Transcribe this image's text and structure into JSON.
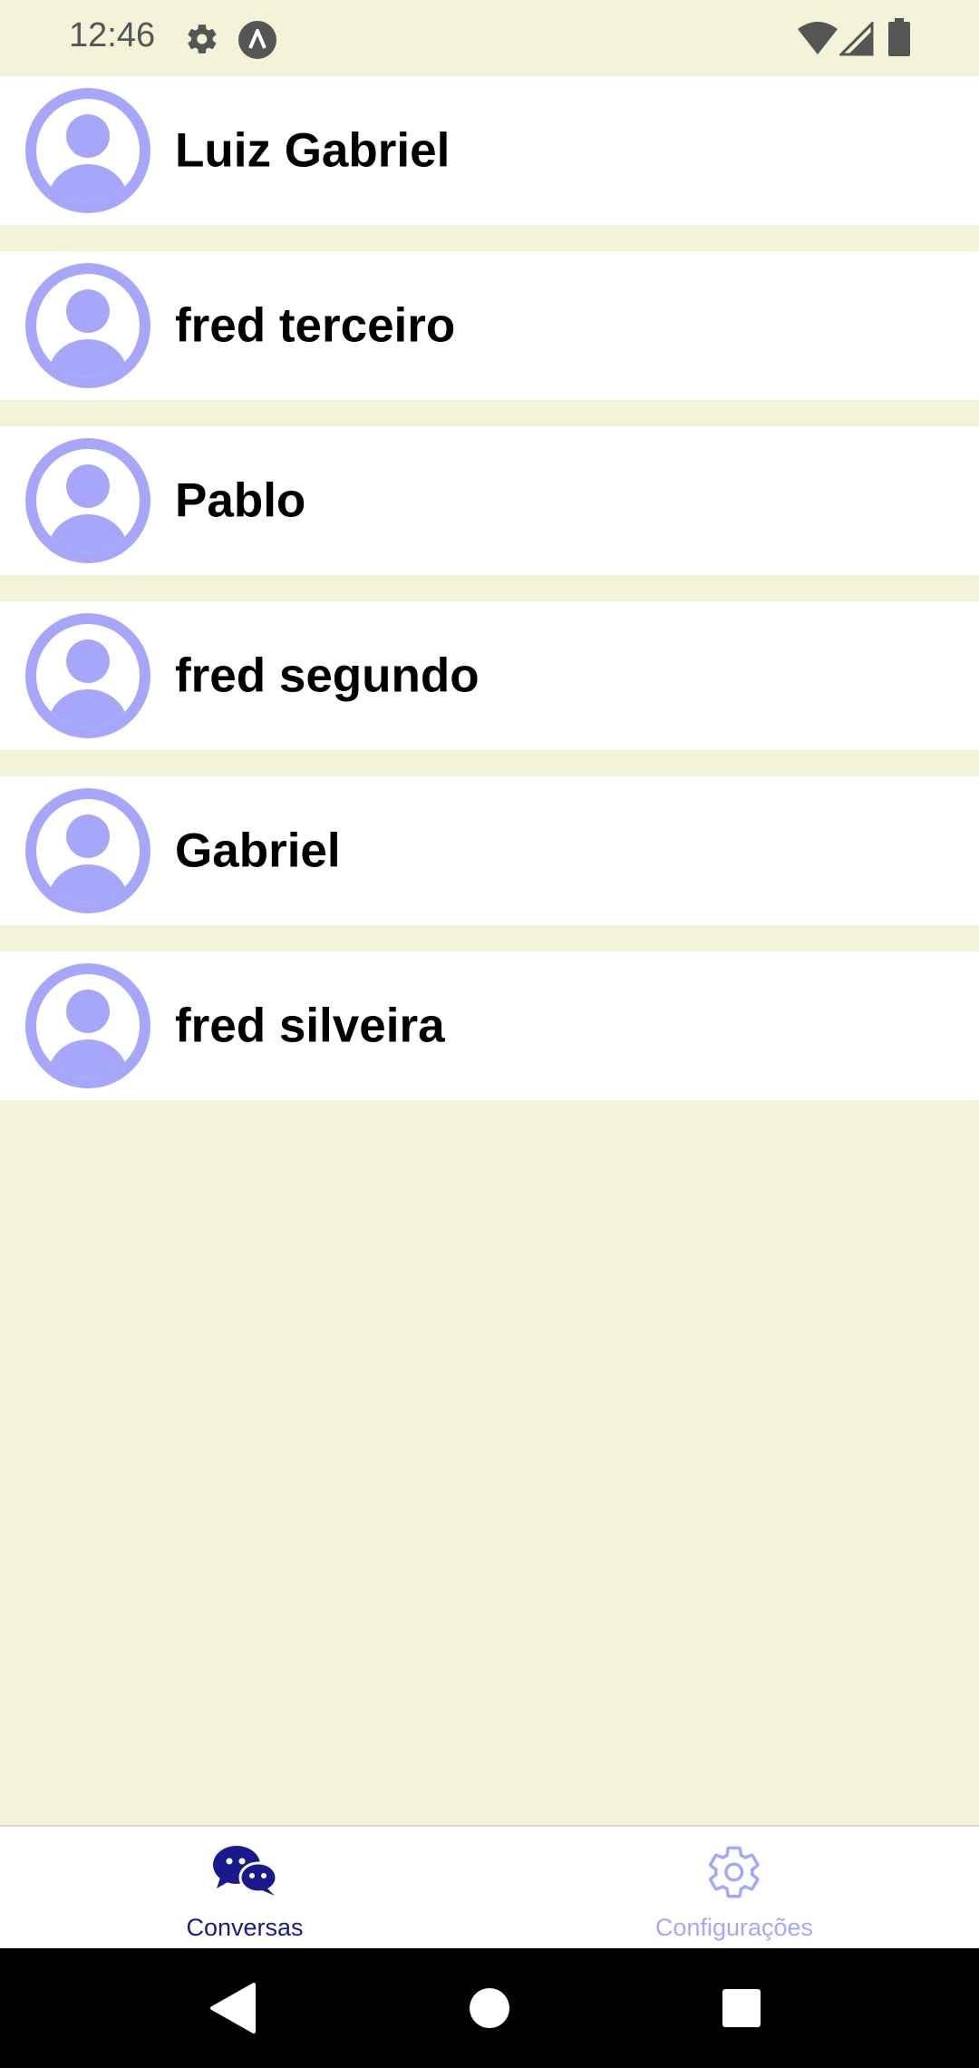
{
  "status_bar": {
    "time": "12:46",
    "icons": [
      "gear-icon",
      "app-notification-icon",
      "wifi-icon",
      "signal-icon",
      "battery-icon"
    ]
  },
  "contacts": [
    {
      "name": "Luiz Gabriel"
    },
    {
      "name": "fred terceiro"
    },
    {
      "name": "Pablo"
    },
    {
      "name": "fred segundo"
    },
    {
      "name": "Gabriel"
    },
    {
      "name": "fred silveira"
    }
  ],
  "tabs": [
    {
      "label": "Conversas",
      "icon": "chat-bubbles-icon",
      "active": true
    },
    {
      "label": "Configurações",
      "icon": "gear-icon",
      "active": false
    }
  ],
  "colors": {
    "background": "#f3f3da",
    "avatar": "#a6a6fb",
    "tab_active": "#1a1a8c",
    "tab_inactive": "#a6a6fb"
  }
}
